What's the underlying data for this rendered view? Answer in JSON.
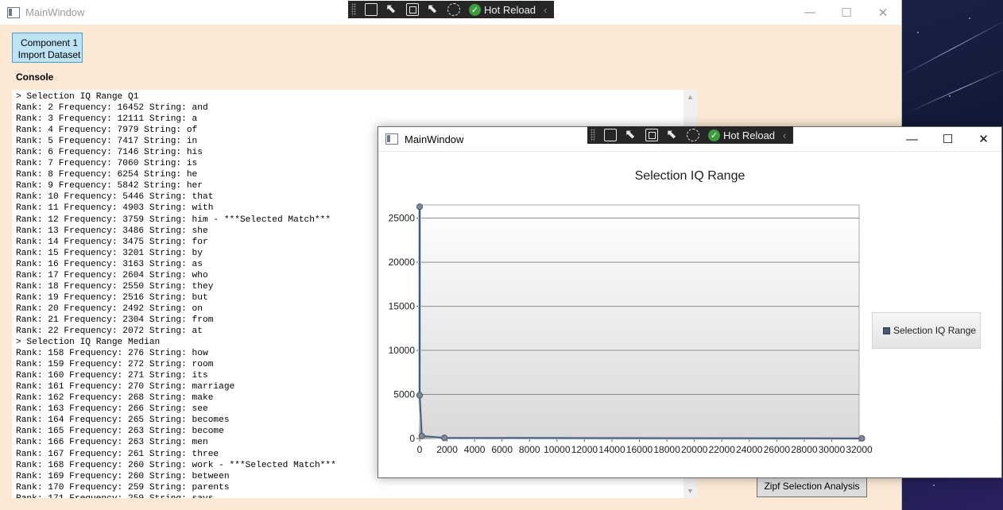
{
  "main_window": {
    "title": "MainWindow",
    "controls": {
      "minimize": "—",
      "maximize": "☐",
      "close": "✕"
    },
    "import_button_label": "Component 1\nImport Dataset",
    "console_label": "Console",
    "console_lines": [
      "> Selection IQ Range Q1",
      "Rank: 2 Frequency: 16452 String: and",
      "Rank: 3 Frequency: 12111 String: a",
      "Rank: 4 Frequency: 7979 String: of",
      "Rank: 5 Frequency: 7417 String: in",
      "Rank: 6 Frequency: 7146 String: his",
      "Rank: 7 Frequency: 7060 String: is",
      "Rank: 8 Frequency: 6254 String: he",
      "Rank: 9 Frequency: 5842 String: her",
      "Rank: 10 Frequency: 5446 String: that",
      "Rank: 11 Frequency: 4903 String: with",
      "Rank: 12 Frequency: 3759 String: him - ***Selected Match***",
      "Rank: 13 Frequency: 3486 String: she",
      "Rank: 14 Frequency: 3475 String: for",
      "Rank: 15 Frequency: 3201 String: by",
      "Rank: 16 Frequency: 3163 String: as",
      "Rank: 17 Frequency: 2604 String: who",
      "Rank: 18 Frequency: 2550 String: they",
      "Rank: 19 Frequency: 2516 String: but",
      "Rank: 20 Frequency: 2492 String: on",
      "Rank: 21 Frequency: 2304 String: from",
      "Rank: 22 Frequency: 2072 String: at",
      "> Selection IQ Range Median",
      "Rank: 158 Frequency: 276 String: how",
      "Rank: 159 Frequency: 272 String: room",
      "Rank: 160 Frequency: 271 String: its",
      "Rank: 161 Frequency: 270 String: marriage",
      "Rank: 162 Frequency: 268 String: make",
      "Rank: 163 Frequency: 266 String: see",
      "Rank: 164 Frequency: 265 String: becomes",
      "Rank: 165 Frequency: 263 String: become",
      "Rank: 166 Frequency: 263 String: men",
      "Rank: 167 Frequency: 261 String: three",
      "Rank: 168 Frequency: 260 String: work - ***Selected Match***",
      "Rank: 169 Frequency: 260 String: between",
      "Rank: 170 Frequency: 259 String: parents",
      "Rank: 171 Frequency: 259 String: says"
    ],
    "zipf_button_label": "Zipf Selection Analysis"
  },
  "hot_reload": {
    "label": "Hot Reload",
    "check_icon": "check-circle-icon",
    "check_color": "#3d9c3d"
  },
  "chart_window": {
    "title": "MainWindow",
    "controls": {
      "minimize": "—",
      "maximize": "☐",
      "close": "✕"
    }
  },
  "chart_data": {
    "type": "line",
    "title": "Selection IQ Range",
    "xlabel": "",
    "ylabel": "",
    "xlim": [
      0,
      32000
    ],
    "ylim": [
      0,
      26500
    ],
    "x_ticks": [
      0,
      2000,
      4000,
      6000,
      8000,
      10000,
      12000,
      14000,
      16000,
      18000,
      20000,
      22000,
      24000,
      26000,
      28000,
      30000,
      32000
    ],
    "y_ticks": [
      0,
      5000,
      10000,
      15000,
      20000,
      25000
    ],
    "grid": "horizontal",
    "legend_position": "right",
    "series": [
      {
        "name": "Selection IQ Range",
        "color": "#475a75",
        "points": [
          [
            1,
            26300
          ],
          [
            2,
            4900
          ],
          [
            158,
            280
          ],
          [
            1800,
            70
          ],
          [
            32200,
            15
          ]
        ]
      }
    ]
  }
}
